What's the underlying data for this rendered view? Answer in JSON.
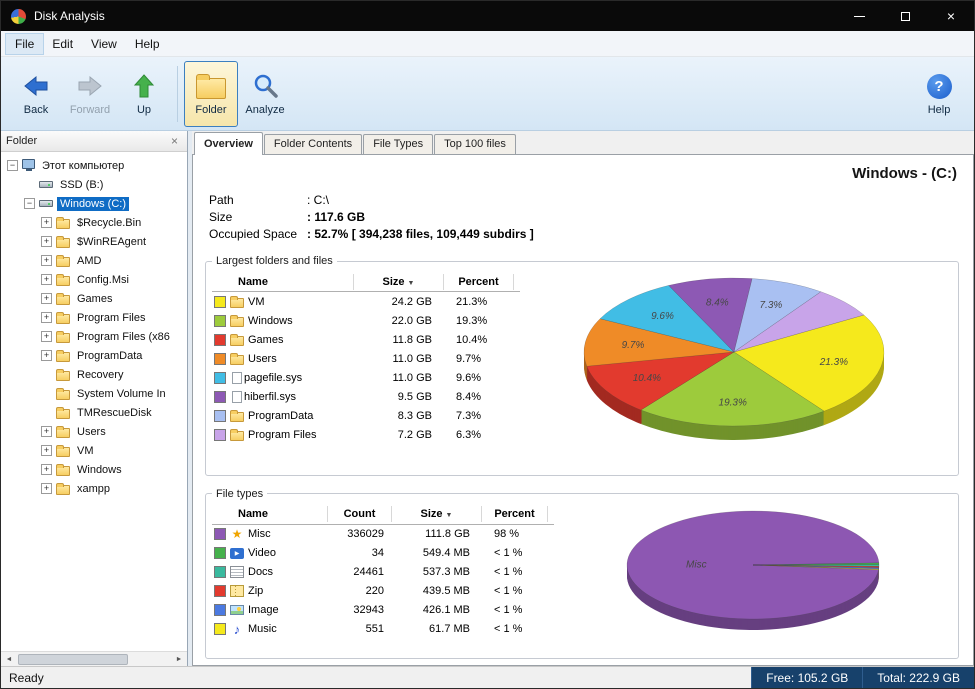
{
  "window": {
    "title": "Disk Analysis"
  },
  "icons": {
    "close_window": "×",
    "sidebar_close": "×",
    "sort_desc": "▼",
    "scroll_left": "◄",
    "scroll_right": "►",
    "expand": "+",
    "collapse": "−",
    "help": "?"
  },
  "menu": [
    "File",
    "Edit",
    "View",
    "Help"
  ],
  "toolbar": {
    "back": "Back",
    "forward": "Forward",
    "up": "Up",
    "folder": "Folder",
    "analyze": "Analyze",
    "help": "Help"
  },
  "sidebar": {
    "header": "Folder",
    "tree": [
      {
        "label": "Этот компьютер",
        "icon": "computer",
        "expander": "collapse",
        "level": 0,
        "selected": false
      },
      {
        "label": "SSD (B:)",
        "icon": "drive",
        "expander": "none",
        "level": 1,
        "selected": false
      },
      {
        "label": "Windows (C:)",
        "icon": "drive",
        "expander": "collapse",
        "level": 1,
        "selected": true
      },
      {
        "label": "$Recycle.Bin",
        "icon": "folder",
        "expander": "expand",
        "level": 2,
        "selected": false
      },
      {
        "label": "$WinREAgent",
        "icon": "folder",
        "expander": "expand",
        "level": 2,
        "selected": false
      },
      {
        "label": "AMD",
        "icon": "folder",
        "expander": "expand",
        "level": 2,
        "selected": false
      },
      {
        "label": "Config.Msi",
        "icon": "folder",
        "expander": "expand",
        "level": 2,
        "selected": false
      },
      {
        "label": "Games",
        "icon": "folder",
        "expander": "expand",
        "level": 2,
        "selected": false
      },
      {
        "label": "Program Files",
        "icon": "folder",
        "expander": "expand",
        "level": 2,
        "selected": false
      },
      {
        "label": "Program Files (x86",
        "icon": "folder",
        "expander": "expand",
        "level": 2,
        "selected": false
      },
      {
        "label": "ProgramData",
        "icon": "folder",
        "expander": "expand",
        "level": 2,
        "selected": false
      },
      {
        "label": "Recovery",
        "icon": "folder",
        "expander": "none",
        "level": 2,
        "selected": false
      },
      {
        "label": "System Volume In",
        "icon": "folder",
        "expander": "none",
        "level": 2,
        "selected": false
      },
      {
        "label": "TMRescueDisk",
        "icon": "folder",
        "expander": "none",
        "level": 2,
        "selected": false
      },
      {
        "label": "Users",
        "icon": "folder",
        "expander": "expand",
        "level": 2,
        "selected": false
      },
      {
        "label": "VM",
        "icon": "folder",
        "expander": "expand",
        "level": 2,
        "selected": false
      },
      {
        "label": "Windows",
        "icon": "folder",
        "expander": "expand",
        "level": 2,
        "selected": false
      },
      {
        "label": "xampp",
        "icon": "folder",
        "expander": "expand",
        "level": 2,
        "selected": false
      }
    ]
  },
  "tabs": [
    {
      "label": "Overview",
      "active": true
    },
    {
      "label": "Folder Contents",
      "active": false
    },
    {
      "label": "File Types",
      "active": false
    },
    {
      "label": "Top 100 files",
      "active": false
    }
  ],
  "overview": {
    "heading": "Windows - (C:)",
    "info": [
      {
        "label": "Path",
        "value": ": C:\\",
        "bold": false
      },
      {
        "label": "Size",
        "value": ": 117.6 GB",
        "bold": true
      },
      {
        "label": "Occupied Space",
        "value": ": 52.7% [ 394,238 files, 109,449 subdirs ]",
        "bold": true
      }
    ],
    "largest": {
      "title": "Largest folders and files",
      "columns": [
        {
          "key": "name",
          "label": "Name",
          "sorted": false
        },
        {
          "key": "size",
          "label": "Size",
          "sorted": true
        },
        {
          "key": "percent",
          "label": "Percent",
          "sorted": false
        }
      ],
      "rows": [
        {
          "name": "VM",
          "icon": "folder",
          "color": "#f5e91c",
          "size": "24.2 GB",
          "percent": "21.3%"
        },
        {
          "name": "Windows",
          "icon": "folder",
          "color": "#9dcb3c",
          "size": "22.0 GB",
          "percent": "19.3%"
        },
        {
          "name": "Games",
          "icon": "folder",
          "color": "#e23a2e",
          "size": "11.8 GB",
          "percent": "10.4%"
        },
        {
          "name": "Users",
          "icon": "folder",
          "color": "#ef8b27",
          "size": "11.0 GB",
          "percent": "9.7%"
        },
        {
          "name": "pagefile.sys",
          "icon": "file",
          "color": "#41bde5",
          "size": "11.0 GB",
          "percent": "9.6%"
        },
        {
          "name": "hiberfil.sys",
          "icon": "file",
          "color": "#8d59b4",
          "size": "9.5 GB",
          "percent": "8.4%"
        },
        {
          "name": "ProgramData",
          "icon": "folder",
          "color": "#a9c0f2",
          "size": "8.3 GB",
          "percent": "7.3%"
        },
        {
          "name": "Program Files",
          "icon": "folder",
          "color": "#c8a4e9",
          "size": "7.2 GB",
          "percent": "6.3%"
        }
      ]
    },
    "filetypes": {
      "title": "File types",
      "columns": [
        {
          "key": "name",
          "label": "Name",
          "sorted": false
        },
        {
          "key": "count",
          "label": "Count",
          "sorted": false
        },
        {
          "key": "size",
          "label": "Size",
          "sorted": true
        },
        {
          "key": "percent",
          "label": "Percent",
          "sorted": false
        }
      ],
      "rows": [
        {
          "name": "Misc",
          "icon": "star",
          "color": "#8d59b4",
          "count": "336029",
          "size": "111.8 GB",
          "percent": "98 %"
        },
        {
          "name": "Video",
          "icon": "video",
          "color": "#46b14c",
          "count": "34",
          "size": "549.4 MB",
          "percent": "< 1 %"
        },
        {
          "name": "Docs",
          "icon": "doc",
          "color": "#3ab99e",
          "count": "24461",
          "size": "537.3 MB",
          "percent": "< 1 %"
        },
        {
          "name": "Zip",
          "icon": "zip",
          "color": "#e23a2e",
          "count": "220",
          "size": "439.5 MB",
          "percent": "< 1 %"
        },
        {
          "name": "Image",
          "icon": "image",
          "color": "#4b79e0",
          "count": "32943",
          "size": "426.1 MB",
          "percent": "< 1 %"
        },
        {
          "name": "Music",
          "icon": "music",
          "color": "#f5e91c",
          "count": "551",
          "size": "61.7 MB",
          "percent": "< 1 %"
        }
      ]
    }
  },
  "statusbar": {
    "ready": "Ready",
    "free": "Free: 105.2 GB",
    "total": "Total: 222.9 GB"
  },
  "chart_data": [
    {
      "type": "pie",
      "title": "Largest folders and files",
      "start_angle_deg": 60,
      "slices": [
        {
          "label": "VM",
          "value": 21.3,
          "color": "#f5e91c",
          "text": "21.3%"
        },
        {
          "label": "Windows",
          "value": 19.3,
          "color": "#9dcb3c",
          "text": "19.3%"
        },
        {
          "label": "Games",
          "value": 10.4,
          "color": "#e23a2e",
          "text": "10.4%"
        },
        {
          "label": "Users",
          "value": 9.7,
          "color": "#ef8b27",
          "text": "9.7%"
        },
        {
          "label": "pagefile.sys",
          "value": 9.6,
          "color": "#41bde5",
          "text": "9.6%"
        },
        {
          "label": "hiberfil.sys",
          "value": 8.4,
          "color": "#8d59b4",
          "text": "8.4%"
        },
        {
          "label": "ProgramData",
          "value": 7.3,
          "color": "#a9c0f2",
          "text": "7.3%"
        },
        {
          "label": "Program Files",
          "value": 6.3,
          "color": "#c8a4e9",
          "text": ""
        }
      ]
    },
    {
      "type": "pie",
      "title": "File types",
      "start_angle_deg": 95,
      "slices": [
        {
          "label": "Misc",
          "value": 98,
          "color": "#8d57b2",
          "text": "Misc"
        },
        {
          "label": "Video",
          "value": 0.5,
          "color": "#46b14c",
          "text": ""
        },
        {
          "label": "Docs",
          "value": 0.5,
          "color": "#3ab99e",
          "text": ""
        },
        {
          "label": "Zip",
          "value": 0.4,
          "color": "#e23a2e",
          "text": ""
        },
        {
          "label": "Image",
          "value": 0.4,
          "color": "#4b79e0",
          "text": ""
        },
        {
          "label": "Music",
          "value": 0.2,
          "color": "#f5e91c",
          "text": ""
        }
      ]
    }
  ]
}
